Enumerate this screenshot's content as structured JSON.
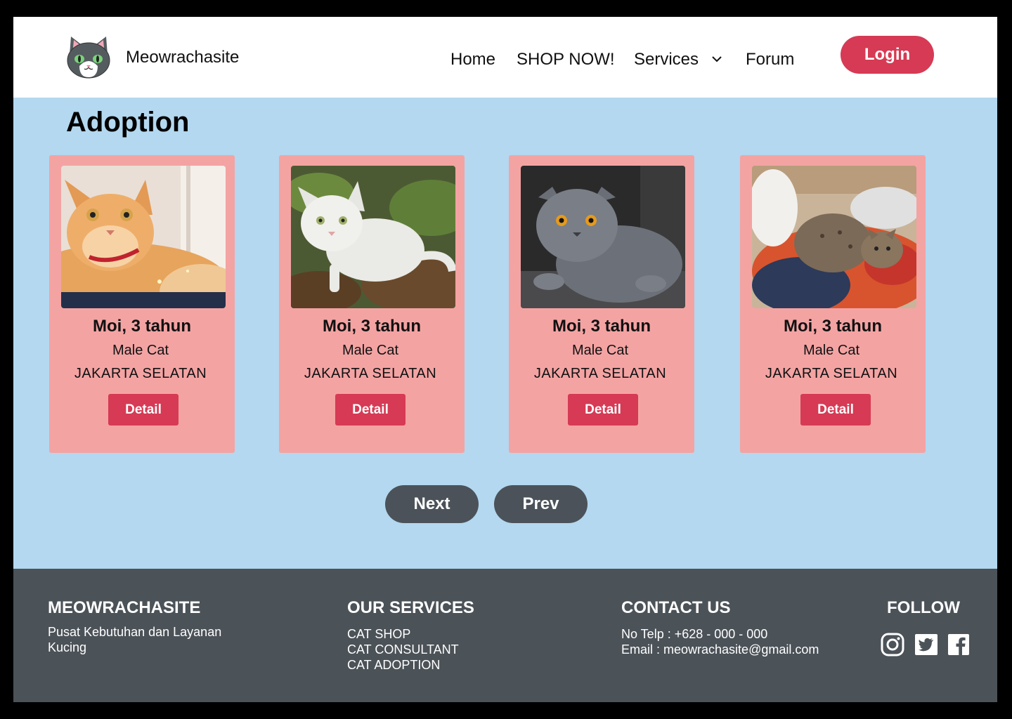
{
  "header": {
    "brand": "Meowrachasite",
    "nav": {
      "home": "Home",
      "shop": "SHOP NOW!",
      "services": "Services",
      "forum": "Forum"
    },
    "login_label": "Login"
  },
  "main": {
    "title": "Adoption",
    "cards": [
      {
        "name": "Moi, 3 tahun",
        "gender": "Male Cat",
        "location": "JAKARTA SELATAN",
        "detail_label": "Detail",
        "photo": "orange-cat-photo"
      },
      {
        "name": "Moi, 3 tahun",
        "gender": "Male Cat",
        "location": "JAKARTA SELATAN",
        "detail_label": "Detail",
        "photo": "white-cat-photo"
      },
      {
        "name": "Moi, 3 tahun",
        "gender": "Male Cat",
        "location": "JAKARTA SELATAN",
        "detail_label": "Detail",
        "photo": "grey-cat-photo"
      },
      {
        "name": "Moi, 3 tahun",
        "gender": "Male Cat",
        "location": "JAKARTA SELATAN",
        "detail_label": "Detail",
        "photo": "kittens-photo"
      }
    ],
    "pager": {
      "next_label": "Next",
      "prev_label": "Prev"
    }
  },
  "footer": {
    "about": {
      "title": "MEOWRACHASITE",
      "line1": "Pusat Kebutuhan dan Layanan",
      "line2": "Kucing"
    },
    "services": {
      "title": "OUR SERVICES",
      "items": [
        "CAT SHOP",
        "CAT CONSULTANT",
        "CAT ADOPTION"
      ]
    },
    "contact": {
      "title": "CONTACT US",
      "phone": "No Telp : +628 - 000 - 000",
      "email": "Email : meowrachasite@gmail.com"
    },
    "follow": {
      "title": "FOLLOW",
      "icons": [
        "instagram-icon",
        "twitter-icon",
        "facebook-icon"
      ]
    }
  },
  "colors": {
    "accent": "#d63a54",
    "page_bg": "#b3d8f0",
    "card_bg": "#f4a3a3",
    "footer_bg": "#4b5258",
    "pager_bg": "#4b5259"
  }
}
